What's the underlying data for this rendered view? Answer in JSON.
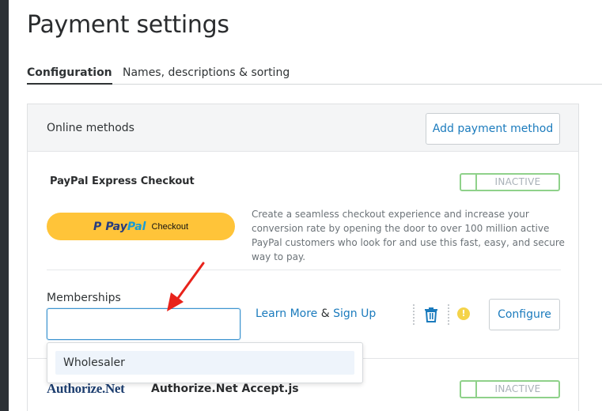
{
  "page": {
    "title": "Payment settings"
  },
  "tabs": [
    {
      "label": "Configuration",
      "active": true
    },
    {
      "label": "Names, descriptions & sorting",
      "active": false
    }
  ],
  "online_methods": {
    "title": "Online methods",
    "add_button": "Add payment method"
  },
  "paypal": {
    "name": "PayPal Express Checkout",
    "status": "INACTIVE",
    "button": {
      "p": "P",
      "word1": "Pay",
      "word2": "Pal",
      "checkout": "Checkout"
    },
    "description": "Create a seamless checkout experience and increase your conversion rate by opening the door to over 100 million active PayPal customers who look for and use this fast, easy, and secure way to pay.",
    "memberships_label": "Memberships",
    "memberships_value": "",
    "learn_more": "Learn More",
    "amp": " & ",
    "sign_up": "Sign Up",
    "warning_glyph": "!",
    "configure_button": "Configure"
  },
  "memberships_dropdown": {
    "options": [
      "Wholesaler"
    ]
  },
  "authorize_net": {
    "logo_text": "Authorize.Net",
    "name": "Authorize.Net Accept.js",
    "status": "INACTIVE"
  },
  "colors": {
    "accent": "#1b7bbd",
    "toggle_border": "#8fd18a",
    "paypal_yellow": "#ffc439",
    "annotation_red": "#e8231b",
    "warning": "#f4d34a"
  },
  "icons": [
    "trash-icon",
    "warning-icon",
    "annotation-arrow-icon"
  ]
}
